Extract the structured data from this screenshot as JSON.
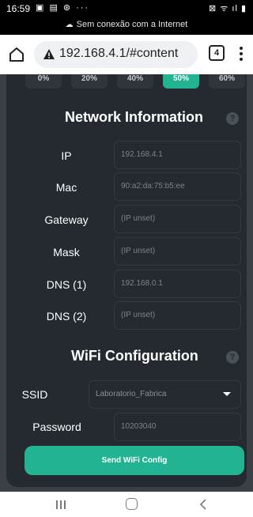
{
  "statusbar": {
    "time": "16:59",
    "left_icons": "▣ ▤ ⊛ ···",
    "right_icons": "⊠ ᯤ ıl ▮",
    "offline_text": "Sem conexão com a Internet"
  },
  "browser": {
    "url": "192.168.4.1/#content",
    "tab_count": "4"
  },
  "percent_buttons": [
    {
      "label": "0%",
      "active": false
    },
    {
      "label": "20%",
      "active": false
    },
    {
      "label": "40%",
      "active": false
    },
    {
      "label": "50%",
      "active": true
    },
    {
      "label": "60%",
      "active": false
    }
  ],
  "network_info": {
    "title": "Network Information",
    "help": "?",
    "fields": [
      {
        "label": "IP",
        "value": "192.168.4.1"
      },
      {
        "label": "Mac",
        "value": "90:a2:da:75:b5:ee"
      },
      {
        "label": "Gateway",
        "value": "(IP unset)"
      },
      {
        "label": "Mask",
        "value": "(IP unset)"
      },
      {
        "label": "DNS (1)",
        "value": "192.168.0.1"
      },
      {
        "label": "DNS (2)",
        "value": "(IP unset)"
      }
    ]
  },
  "wifi_config": {
    "title": "WiFi Configuration",
    "help": "?",
    "ssid_label": "SSID",
    "ssid_value": "Laboratorio_Fabrica",
    "password_label": "Password",
    "password_value": "10203040",
    "send_label": "Send WiFi Config"
  },
  "colors": {
    "accent": "#22b492",
    "card_bg": "#242a30",
    "page_bg": "#3b4046"
  }
}
